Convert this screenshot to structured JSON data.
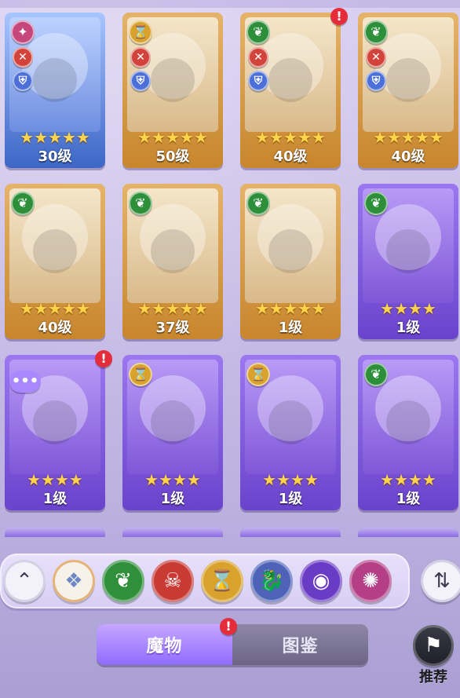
{
  "monsters": [
    {
      "level": "30级",
      "stars": "★★★★★",
      "style": "blue",
      "element_icon": "pink-swirl-icon",
      "element_glyph": "✦",
      "icons": [
        "attack-icon",
        "defense-icon"
      ],
      "alert": ""
    },
    {
      "level": "50级",
      "stars": "★★★★★",
      "style": "gold",
      "element_icon": "gold-hourglass-icon",
      "element_glyph": "⌛",
      "icons": [
        "attack-icon",
        "defense-icon"
      ],
      "alert": ""
    },
    {
      "level": "40级",
      "stars": "★★★★★",
      "style": "gold",
      "element_icon": "green-leaf-icon",
      "element_glyph": "❦",
      "icons": [
        "attack-icon",
        "defense-icon"
      ],
      "alert": "!"
    },
    {
      "level": "40级",
      "stars": "★★★★★",
      "style": "gold",
      "element_icon": "green-leaf-icon",
      "element_glyph": "❦",
      "icons": [
        "attack-icon",
        "defense-icon"
      ],
      "alert": ""
    },
    {
      "level": "40级",
      "stars": "★★★★★",
      "style": "gold",
      "element_icon": "green-leaf-icon",
      "element_glyph": "❦",
      "icons": [],
      "alert": ""
    },
    {
      "level": "37级",
      "stars": "★★★★★",
      "style": "gold",
      "element_icon": "green-leaf-icon",
      "element_glyph": "❦",
      "icons": [],
      "alert": ""
    },
    {
      "level": "1级",
      "stars": "★★★★★",
      "style": "gold",
      "element_icon": "green-leaf-icon",
      "element_glyph": "❦",
      "icons": [],
      "alert": ""
    },
    {
      "level": "1级",
      "stars": "★★★★",
      "style": "purple",
      "element_icon": "green-leaf-icon",
      "element_glyph": "❦",
      "icons": [],
      "alert": ""
    },
    {
      "level": "1级",
      "stars": "★★★★",
      "style": "purple",
      "element_icon": "chat-bubble-icon",
      "element_glyph": "",
      "icons": [],
      "alert": "!"
    },
    {
      "level": "1级",
      "stars": "★★★★",
      "style": "purple",
      "element_icon": "gold-hourglass-icon",
      "element_glyph": "⌛",
      "icons": [],
      "alert": ""
    },
    {
      "level": "1级",
      "stars": "★★★★",
      "style": "purple",
      "element_icon": "gold-hourglass-icon",
      "element_glyph": "⌛",
      "icons": [],
      "alert": ""
    },
    {
      "level": "1级",
      "stars": "★★★★",
      "style": "purple",
      "element_icon": "green-leaf-icon",
      "element_glyph": "❦",
      "icons": [],
      "alert": ""
    }
  ],
  "chat_bubble": "•••",
  "filters": [
    {
      "name": "collapse-filters-button",
      "glyph": "⌃",
      "class": "up"
    },
    {
      "name": "filter-all-button",
      "glyph": "❖",
      "class": "all"
    },
    {
      "name": "filter-nature-button",
      "glyph": "❦",
      "class": "green"
    },
    {
      "name": "filter-demon-button",
      "glyph": "☠",
      "class": "red"
    },
    {
      "name": "filter-time-button",
      "glyph": "⌛",
      "class": "gold"
    },
    {
      "name": "filter-dragon-button",
      "glyph": "🐉",
      "class": "blue"
    },
    {
      "name": "filter-eye-button",
      "glyph": "◉",
      "class": "purple"
    },
    {
      "name": "filter-chaos-button",
      "glyph": "✺",
      "class": "pink"
    }
  ],
  "sort_glyph": "⇅",
  "tabs": {
    "monster": "魔物",
    "codex": "图鉴",
    "codex_alert": "!"
  },
  "recommend": {
    "label": "推荐",
    "glyph": "⚑"
  }
}
